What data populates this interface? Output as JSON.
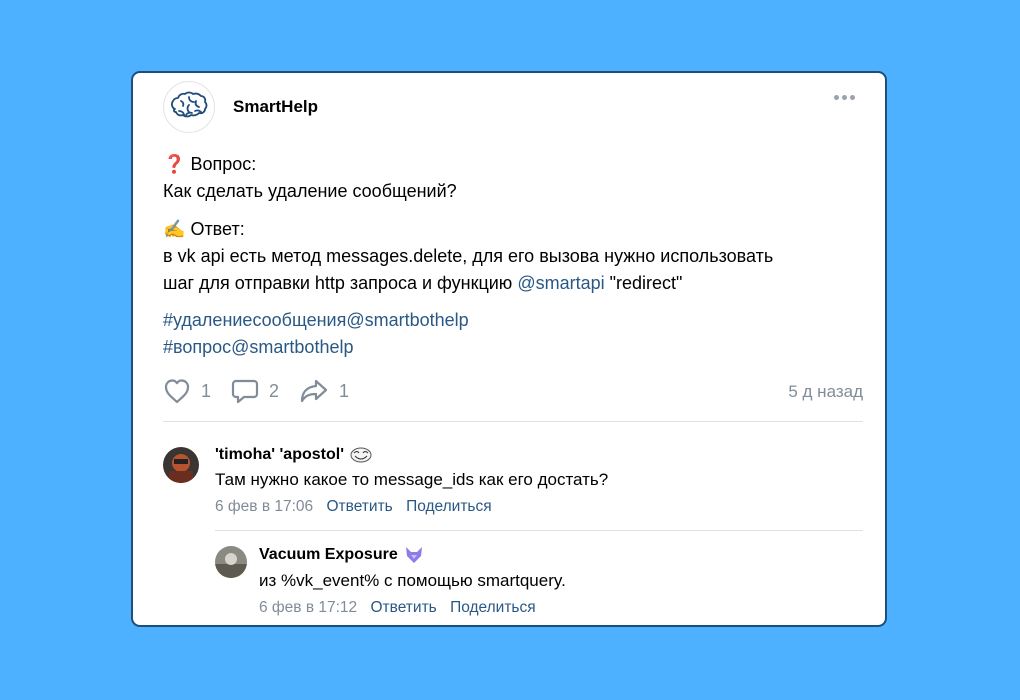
{
  "post": {
    "author": "SmartHelp",
    "question_label": "Вопрос:",
    "question_text": "Как сделать удаление сообщений?",
    "answer_label": "Ответ:",
    "answer_line1": "в vk api есть метод messages.delete, для его вызова нужно использовать",
    "answer_line2_prefix": "шаг для отправки http запроса и функцию ",
    "answer_mention": "@smartapi",
    "answer_line2_suffix": " \"redirect\"",
    "tags": [
      "#удалениесообщения@smartbothelp",
      "#вопрос@smartbothelp"
    ],
    "likes": "1",
    "comments": "2",
    "shares": "1",
    "date": "5 д назад",
    "avatar_icon": "brain-logo-icon",
    "question_icon": "red-question-mark-icon",
    "answer_icon": "writing-hand-icon"
  },
  "comments": [
    {
      "author": "'timoha' 'apostol'",
      "badge_icon": "troll-face-icon",
      "text": "Там нужно какое то message_ids как его достать?",
      "date": "6 фев в 17:06",
      "reply_label": "Ответить",
      "share_label": "Поделиться",
      "replies": [
        {
          "author": "Vacuum Exposure",
          "badge_icon": "fox-icon",
          "text": "из %vk_event% с помощью smartquery.",
          "date": "6 фев в 17:12",
          "reply_label": "Ответить",
          "share_label": "Поделиться"
        }
      ]
    }
  ],
  "colors": {
    "background": "#4db1ff",
    "link": "#2a5885",
    "muted": "#818c99",
    "card_border": "#1d4f7a"
  }
}
